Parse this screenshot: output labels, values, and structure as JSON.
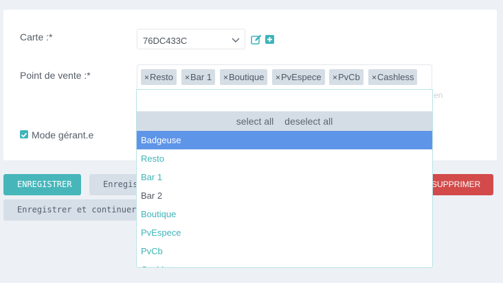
{
  "form": {
    "carte_label": "Carte :*",
    "carte_value": "76DC433C",
    "point_vente_label": "Point de vente :*",
    "selected_tags": [
      "Resto",
      "Bar 1",
      "Boutique",
      "PvEspece",
      "PvCb",
      "Cashless"
    ],
    "tag_remove_glyph": "×",
    "hint_fragment": "en",
    "mode_gerant_label": "Mode gérant.e"
  },
  "dropdown": {
    "search_placeholder": "",
    "select_all": "select all",
    "deselect_all": "deselect all",
    "options": [
      "Badgeuse",
      "Resto",
      "Bar 1",
      "Bar 2",
      "Boutique",
      "PvEspece",
      "PvCb",
      "Cashless"
    ],
    "highlighted_index": 0
  },
  "buttons": {
    "save": "ENREGISTRER",
    "save_add": "Enregistrer et ajouter",
    "save_continue": "Enregistrer et continuer les modifications",
    "delete": "SUPPRIMER"
  },
  "colors": {
    "accent": "#47b6bb",
    "highlight": "#5f95e8",
    "danger": "#d24a4a",
    "background": "#edf1f5"
  }
}
